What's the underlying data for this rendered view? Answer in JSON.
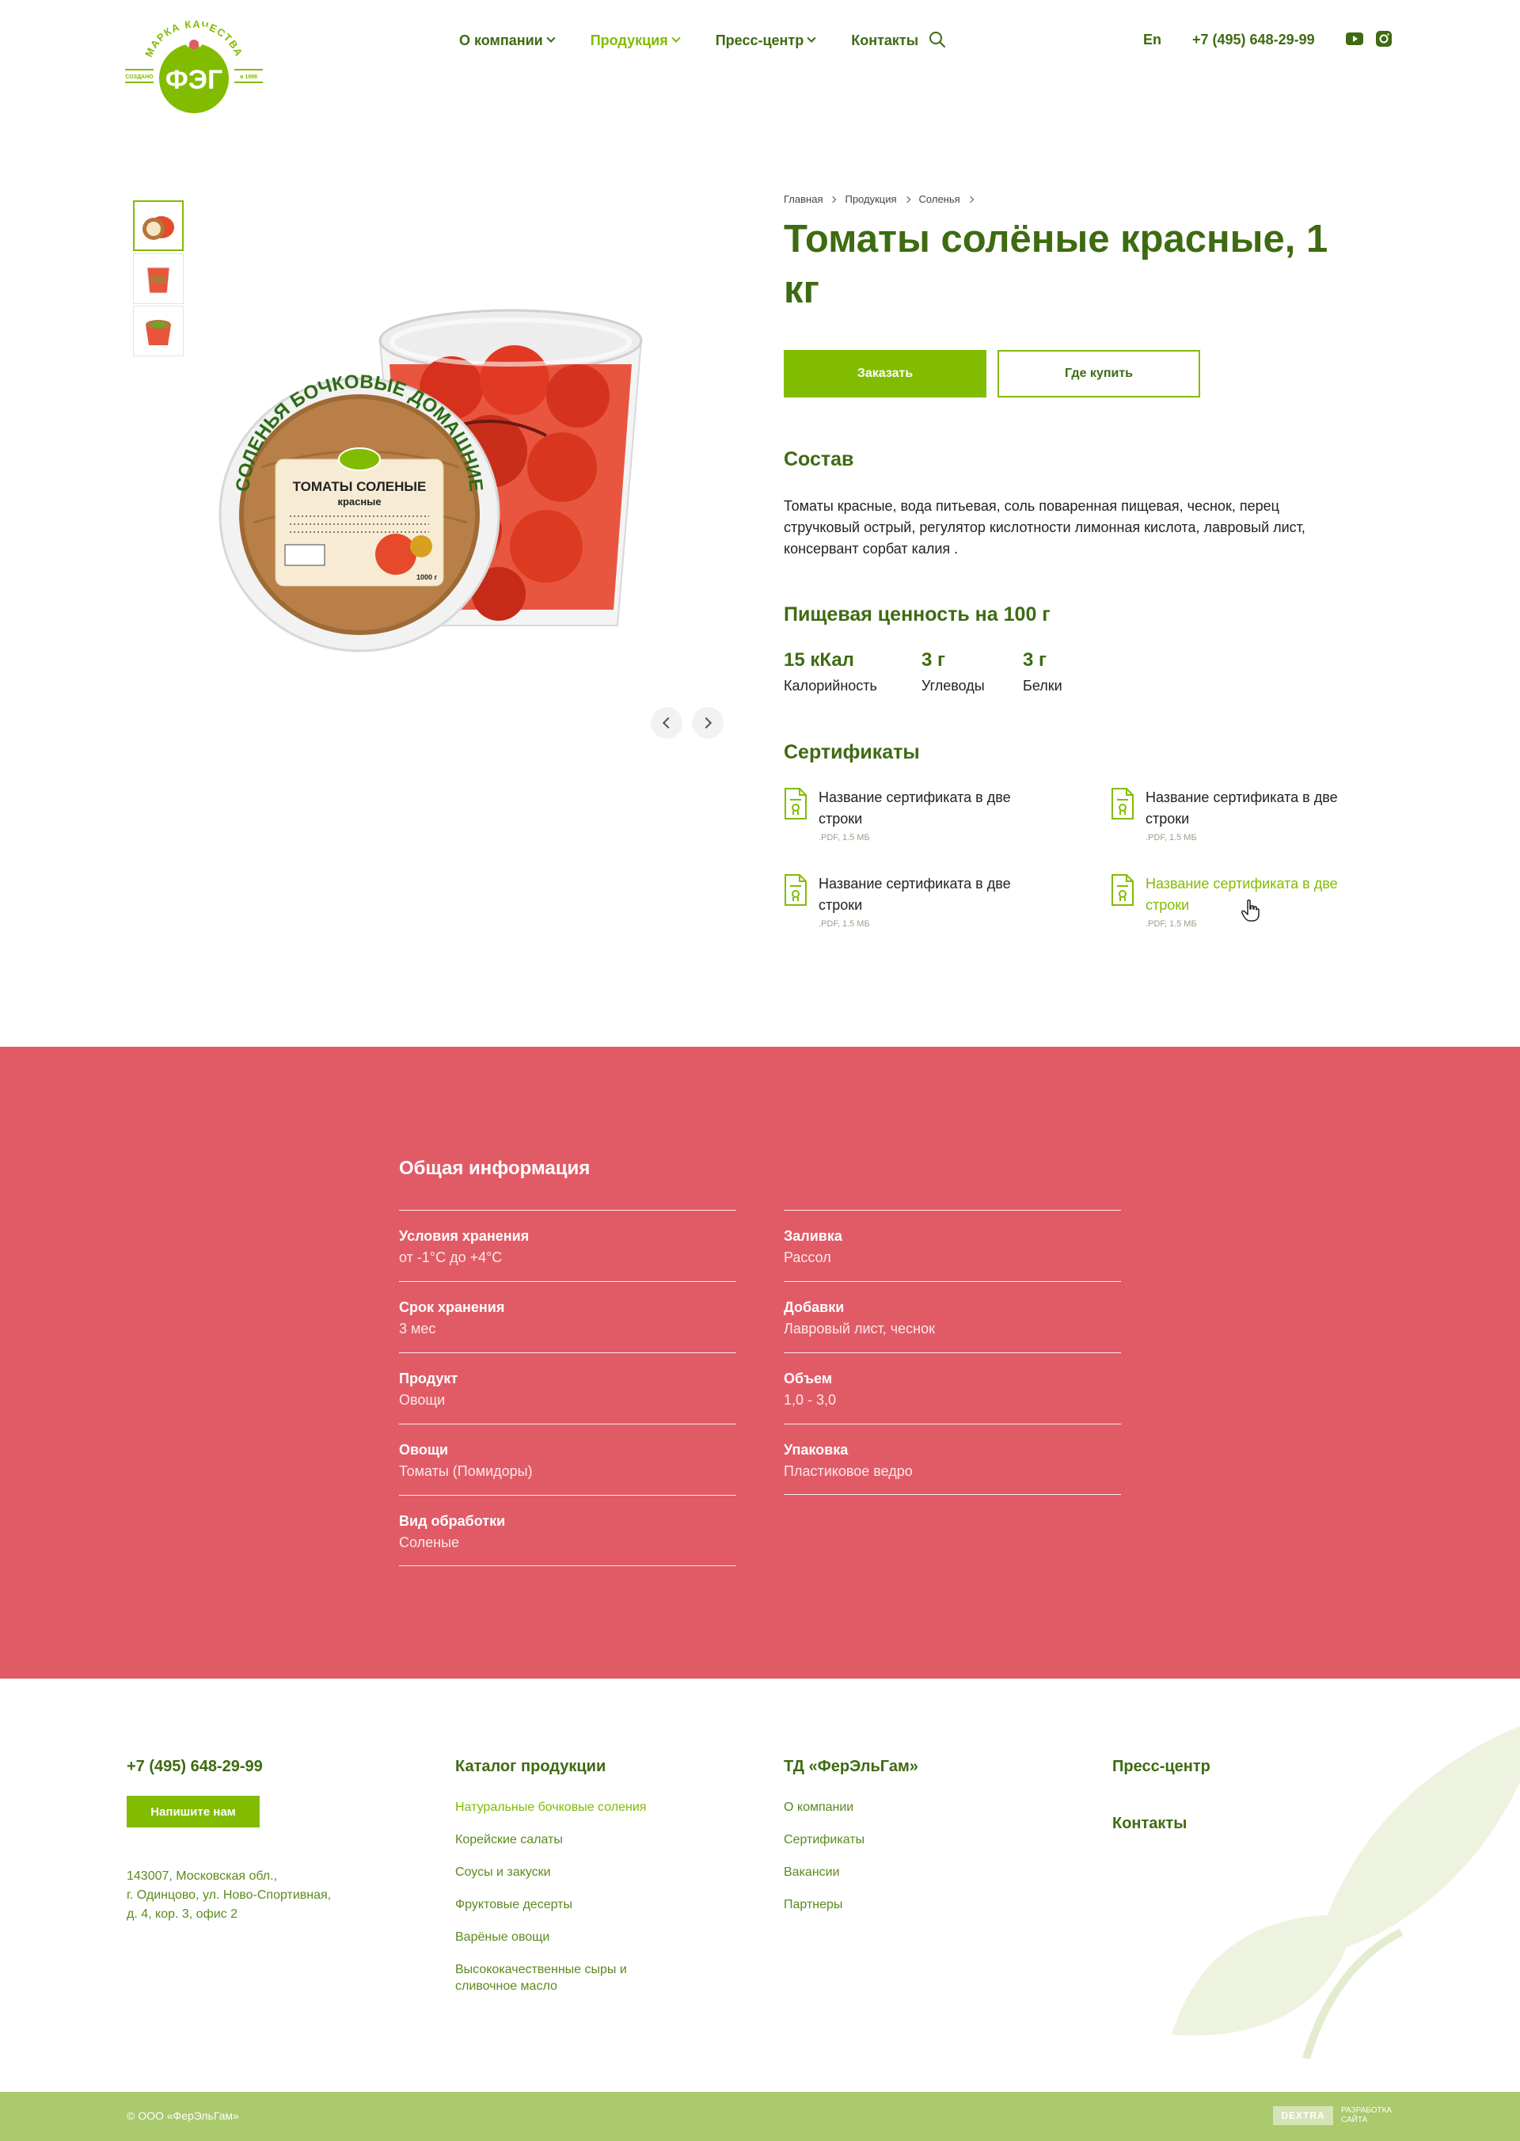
{
  "header": {
    "logo_text": "ФЭГ",
    "logo_arc": "МАРКА КАЧЕСТВА",
    "logo_left": "СОЗДАНО",
    "logo_right": "в 1998",
    "nav": [
      {
        "label": "О компании",
        "dropdown": true,
        "active": false
      },
      {
        "label": "Продукция",
        "dropdown": true,
        "active": true
      },
      {
        "label": "Пресс-центр",
        "dropdown": true,
        "active": false
      },
      {
        "label": "Контакты",
        "dropdown": false,
        "active": false
      }
    ],
    "search_icon": "search-icon",
    "lang": "En",
    "phone": "+7 (495) 648-29-99",
    "social": [
      "youtube-icon",
      "instagram-icon"
    ]
  },
  "gallery": {
    "thumb_count": 3,
    "active_thumb": 0,
    "image_label_top": "ТОМАТЫ СОЛЕНЫЕ",
    "image_label_bottom": "красные",
    "image_arc": "СОЛЕНЬЯ БОЧКОВЫЕ ДОМАШНИЕ",
    "image_weight": "1000 г"
  },
  "product": {
    "breadcrumb": [
      "Главная",
      "Продукция",
      "Соленья"
    ],
    "title": "Томаты солёные красные, 1 кг",
    "order_button": "Заказать",
    "where_button": "Где купить",
    "composition_title": "Состав",
    "composition_text": "Томаты красные, вода питьевая, соль поваренная пищевая, чеснок, перец стручковый острый, регулятор кислотности лимонная кислота, лавровый лист, консервант сорбат калия .",
    "nutrition_title": "Пищевая ценность на 100 г",
    "nutrition": [
      {
        "value": "15 кКал",
        "label": "Калорийность"
      },
      {
        "value": "3 г",
        "label": "Углеводы"
      },
      {
        "value": "3 г",
        "label": "Белки"
      }
    ],
    "certificates_title": "Сертификаты",
    "certificates": [
      {
        "title": "Название сертификата в две строки",
        "meta": ".PDF,  1.5 МБ",
        "hover": false
      },
      {
        "title": "Название сертификата в две строки",
        "meta": ".PDF,  1.5 МБ",
        "hover": false
      },
      {
        "title": "Название сертификата в две строки",
        "meta": ".PDF,  1.5 МБ",
        "hover": false
      },
      {
        "title": "Название сертификата в две строки",
        "meta": ".PDF,  1.5 МБ",
        "hover": true
      }
    ]
  },
  "general_info": {
    "title": "Общая информация",
    "left": [
      {
        "key": "Условия хранения",
        "value": "от -1°С до +4°С"
      },
      {
        "key": "Срок хранения",
        "value": "3 мес"
      },
      {
        "key": "Продукт",
        "value": "Овощи"
      },
      {
        "key": "Овощи",
        "value": "Томаты (Помидоры)"
      },
      {
        "key": "Вид обработки",
        "value": "Соленые"
      }
    ],
    "right": [
      {
        "key": "Заливка",
        "value": "Рассол"
      },
      {
        "key": "Добавки",
        "value": "Лавровый лист, чеснок"
      },
      {
        "key": "Объем",
        "value": "1,0 - 3,0"
      },
      {
        "key": "Упаковка",
        "value": "Пластиковое ведро"
      }
    ]
  },
  "footer": {
    "phone": "+7 (495) 648-29-99",
    "write_button": "Напишите нам",
    "address": [
      "143007, Московская обл.,",
      "г. Одинцово, ул. Ново-Спортивная,",
      "д. 4, кор. 3, офис 2"
    ],
    "catalog_title": "Каталог продукции",
    "catalog": [
      "Натуральные бочковые соления",
      "Корейские салаты",
      "Соусы и закуски",
      "Фруктовые десерты",
      "Варёные овощи",
      "Высококачественные сыры и сливочное масло"
    ],
    "company_title": "ТД «ФерЭльГам»",
    "company": [
      "О компании",
      "Сертификаты",
      "Вакансии",
      "Партнеры"
    ],
    "press": "Пресс-центр",
    "contacts": "Контакты",
    "copyright": "© ООО «ФерЭльГам»",
    "dev_logo": "DEXTRA",
    "dev_text": "РАЗРАБОТКА САЙТА"
  },
  "colors": {
    "brand_green": "#82bc00",
    "dark_green": "#3e6b12",
    "info_bg": "#e15b66",
    "bottom_bar": "#abc96d"
  }
}
